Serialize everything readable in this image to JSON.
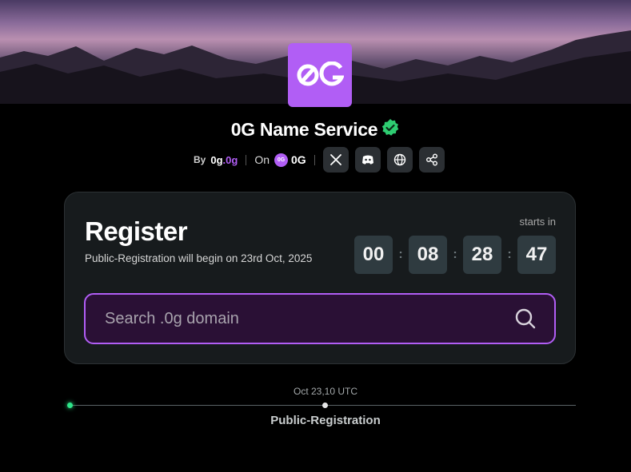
{
  "header": {
    "logo_text": "0G",
    "title": "0G Name Service",
    "verified_icon": "verified-badge-icon",
    "by_label": "By",
    "by_brand_main": "0g",
    "by_brand_accent": ".0g",
    "on_label": "On",
    "chain_icon_text": "0G",
    "chain_name": "0G",
    "social_icons": [
      "x-icon",
      "discord-icon",
      "globe-icon",
      "share-icon"
    ]
  },
  "register": {
    "title": "Register",
    "subtitle": "Public-Registration will begin on 23rd Oct, 2025",
    "starts_label": "starts in",
    "countdown": [
      "00",
      "08",
      "28",
      "47"
    ]
  },
  "search": {
    "placeholder": "Search .0g domain",
    "icon": "search-icon"
  },
  "timeline": {
    "date": "Oct 23,10 UTC",
    "label": "Public-Registration"
  },
  "colors": {
    "accent": "#b15ef5",
    "verified": "#2ecc71",
    "timeline_start": "#2ee68a",
    "card_bg": "#171b1d",
    "search_bg": "#2a1035"
  }
}
